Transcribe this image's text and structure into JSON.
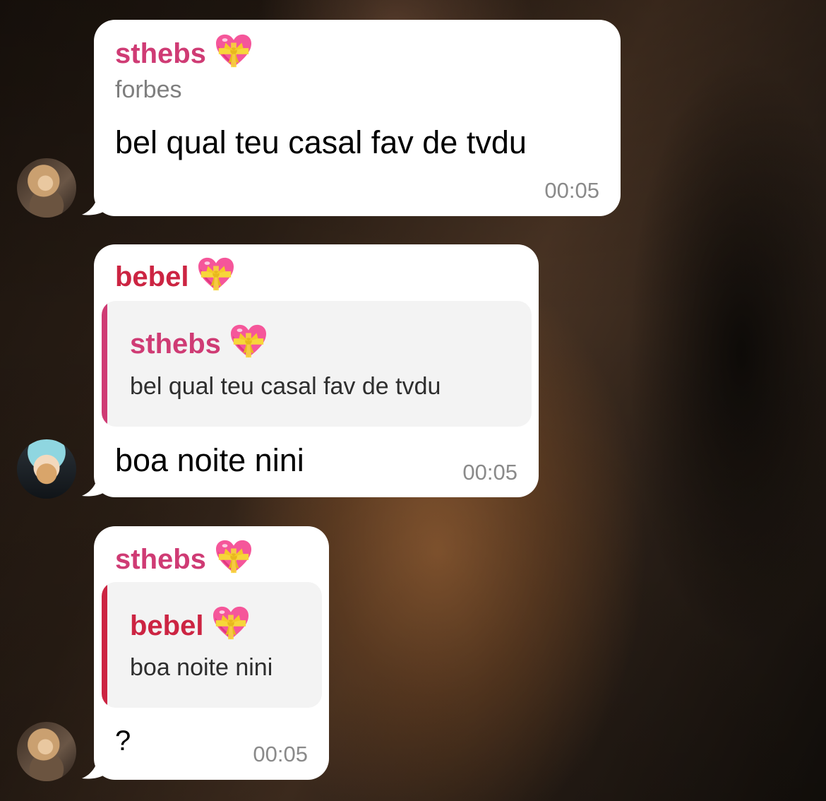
{
  "colors": {
    "sthebs_name": "#cf3b74",
    "bebel_name": "#cc2442",
    "bubble_bg": "#ffffff",
    "quote_bg": "#f3f3f3",
    "time_text": "#8a8a8a"
  },
  "messages": [
    {
      "sender": "sthebs",
      "sender_emoji": "heart-with-ribbon-icon",
      "subtitle": "forbes",
      "text": "bel qual teu casal fav de tvdu",
      "time": "00:05"
    },
    {
      "sender": "bebel",
      "sender_emoji": "heart-with-ribbon-icon",
      "reply_to": {
        "sender": "sthebs",
        "text": "bel qual teu casal fav de tvdu"
      },
      "text": "boa noite nini",
      "time": "00:05"
    },
    {
      "sender": "sthebs",
      "sender_emoji": "heart-with-ribbon-icon",
      "reply_to": {
        "sender": "bebel",
        "text": "boa noite nini"
      },
      "text": "?",
      "time": "00:05"
    }
  ]
}
